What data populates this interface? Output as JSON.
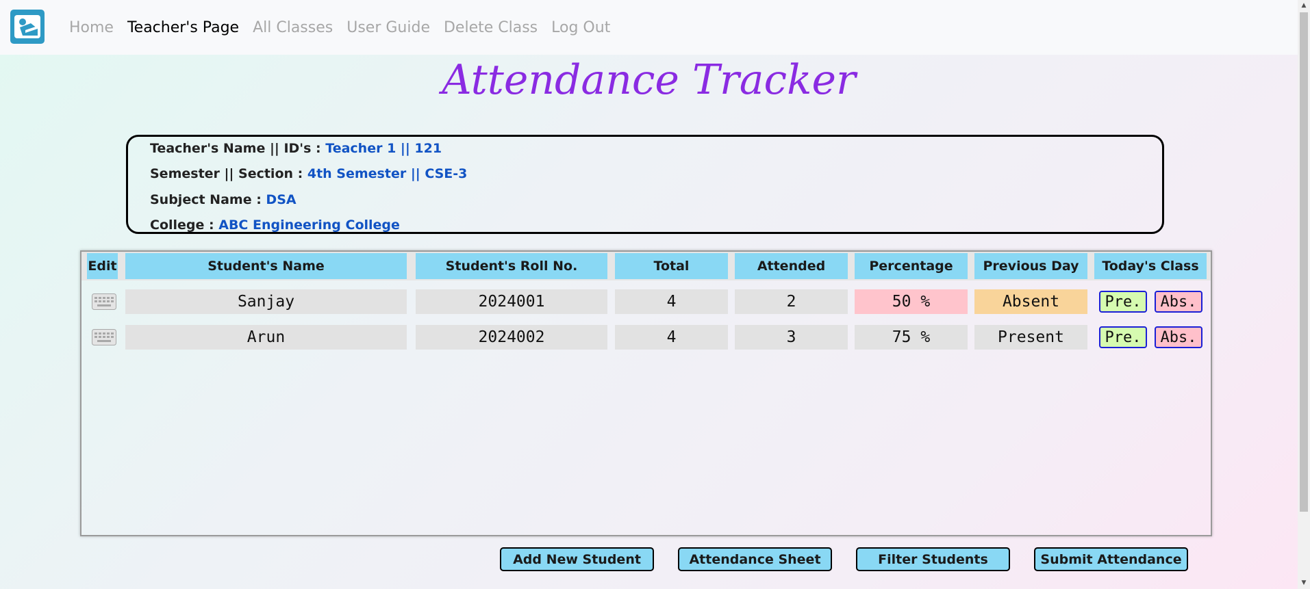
{
  "nav": {
    "items": [
      {
        "label": "Home",
        "active": false
      },
      {
        "label": "Teacher's Page",
        "active": true
      },
      {
        "label": "All Classes",
        "active": false
      },
      {
        "label": "User Guide",
        "active": false
      },
      {
        "label": "Delete Class",
        "active": false
      },
      {
        "label": "Log Out",
        "active": false
      }
    ],
    "logo_icon": "person-reading-icon"
  },
  "page": {
    "title": "Attendance Tracker"
  },
  "info": {
    "teacher_label": "Teacher's Name || ID's :",
    "teacher_value": "Teacher 1 || 121",
    "semester_label": "Semester || Section :",
    "semester_value": "4th Semester || CSE-3",
    "subject_label": "Subject Name :",
    "subject_value": "DSA",
    "college_label": "College :",
    "college_value": "ABC Engineering College"
  },
  "table": {
    "headers": {
      "edit": "Edit",
      "name": "Student's Name",
      "roll": "Student's Roll No.",
      "total": "Total",
      "attended": "Attended",
      "percentage": "Percentage",
      "previous": "Previous Day",
      "today": "Today's Class"
    },
    "rows": [
      {
        "name": "Sanjay",
        "roll": "2024001",
        "total": "4",
        "attended": "2",
        "percentage": "50 %",
        "previous": "Absent",
        "pre_label": "Pre.",
        "abs_label": "Abs."
      },
      {
        "name": "Arun",
        "roll": "2024002",
        "total": "4",
        "attended": "3",
        "percentage": "75 %",
        "previous": "Present",
        "pre_label": "Pre.",
        "abs_label": "Abs."
      }
    ]
  },
  "actions": {
    "add": "Add New Student",
    "sheet": "Attendance Sheet",
    "filter": "Filter Students",
    "submit": "Submit Attendance"
  },
  "colors": {
    "accent": "#89d8f4",
    "title": "#8a2be2",
    "info_value": "#1153c4",
    "low_percentage": "#ffc4cc",
    "absent": "#f9d49a",
    "present_button": "#d6fbb0",
    "absent_button": "#ffc0ca"
  }
}
